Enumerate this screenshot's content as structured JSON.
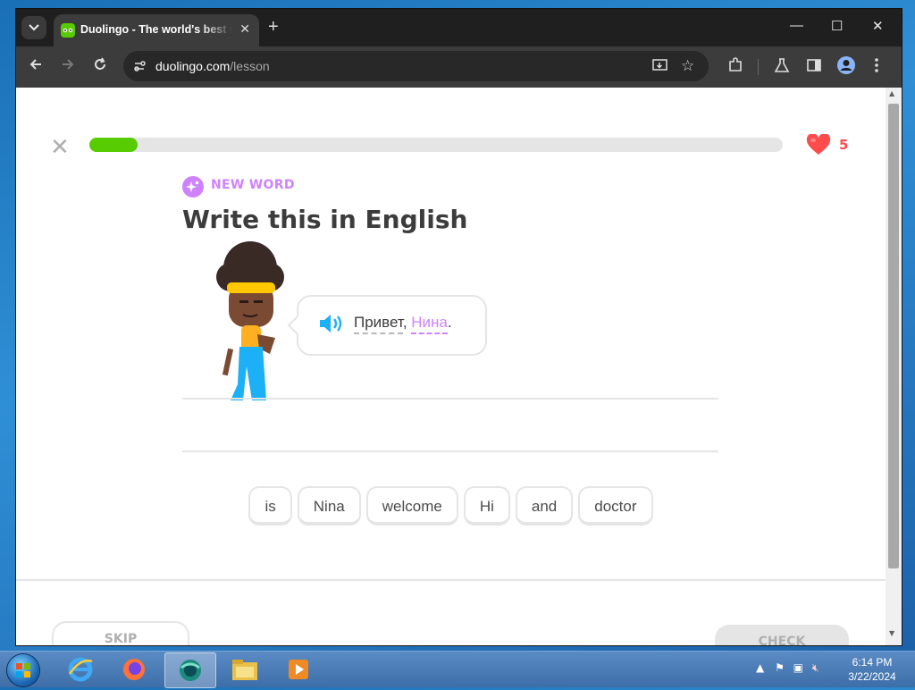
{
  "browser": {
    "tab_title": "Duolingo - The world's best way to learn a language",
    "url_domain": "duolingo.com",
    "url_path": "/lesson",
    "new_tab_icon": "+",
    "minimize_icon": "—",
    "maximize_icon": "☐",
    "close_icon": "✕"
  },
  "lesson": {
    "progress_fraction": 0.07,
    "hearts": "5",
    "badge_label": "NEW WORD",
    "heading": "Write this in English",
    "phrase": {
      "word1": "Привет",
      "sep": ", ",
      "word2": "Нина",
      "end": "."
    },
    "word_bank": [
      "is",
      "Nina",
      "welcome",
      "Hi",
      "and",
      "doctor"
    ],
    "skip_label": "SKIP",
    "check_label": "CHECK"
  },
  "taskbar": {
    "time": "6:14 PM",
    "date": "3/22/2024"
  },
  "colors": {
    "progress_green": "#58cc02",
    "heart_red": "#ff4b4b",
    "new_word_purple": "#ce82ff"
  }
}
